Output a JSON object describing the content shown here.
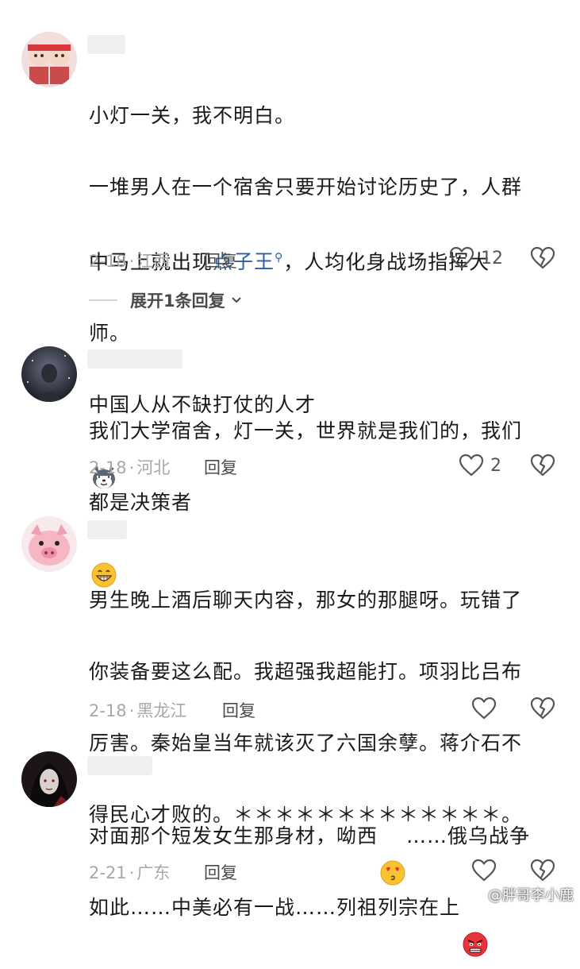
{
  "comments": [
    {
      "text_lines": [
        "小灯一关，我不明白。",
        "一堆男人在一个宿舍只要开始讨论历史了，人群",
        "中马上就出现",
        "，人均化身战场指挥大",
        "师。",
        "中国人从不缺打仗的人才"
      ],
      "link": "点子王",
      "date": "2-18",
      "location": "江西",
      "reply_label": "回复",
      "likes": "12",
      "emoji": "husky-emoji"
    },
    {
      "text_lines": [
        "我们大学宿舍，灯一关，世界就是我们的，我们",
        "都是决策者"
      ],
      "date": "2-18",
      "location": "河北",
      "reply_label": "回复",
      "likes": "2",
      "emoji": "grin-emoji"
    },
    {
      "text_lines": [
        "男生晚上酒后聊天内容，那女的那腿呀。玩错了",
        "你装备要这么配。我超强我超能打。项羽比吕布",
        "厉害。秦始皇当年就该灭了六国余孽。蒋介石不",
        "得民心才败的。＊＊＊＊＊＊＊＊＊＊＊＊＊。"
      ],
      "date": "2-18",
      "location": "黑龙江",
      "reply_label": "回复"
    },
    {
      "text_lines": [
        "对面那个短发女生那身材，呦西",
        "……俄乌战争",
        "如此……中美必有一战……列祖列宗在上"
      ],
      "date": "2-21",
      "location": "广东",
      "reply_label": "回复"
    }
  ],
  "expand_replies": "展开1条回复",
  "watermark": "@胖哥李小鹿"
}
